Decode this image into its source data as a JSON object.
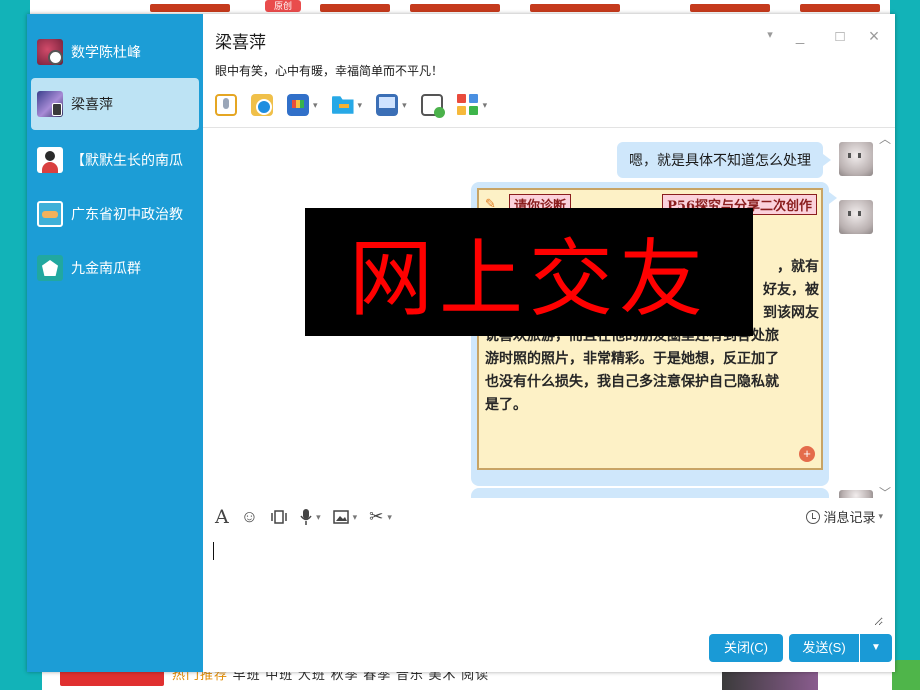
{
  "background_page": {
    "top_tag": "原创",
    "bottom_links": [
      "热门推荐",
      "早班",
      "中班",
      "大班",
      "秋季",
      "春季",
      "音乐",
      "美术",
      "阅读"
    ]
  },
  "sidebar": {
    "items": [
      {
        "label": "数学陈杜峰",
        "active": false
      },
      {
        "label": "梁喜萍",
        "active": true
      },
      {
        "label": "【默默生长的南瓜",
        "active": false
      },
      {
        "label": "广东省初中政治教",
        "active": false
      },
      {
        "label": "九金南瓜群",
        "active": false
      }
    ]
  },
  "header": {
    "title": "梁喜萍",
    "signature": "眼中有笑，心中有暖，幸福简单而不平凡！",
    "controls": {
      "menu": "▾",
      "minimize": "_",
      "maximize": "□",
      "close": "×"
    }
  },
  "toolbar": {
    "tools": [
      "voice-icon",
      "video-icon",
      "screen-share-icon",
      "file-transfer-icon",
      "remote-assist-icon",
      "chat-bubble-icon",
      "apps-icon"
    ]
  },
  "messages": {
    "text_bubble": "嗯，就是具体不知道怎么处理",
    "card": {
      "tag_left": "请你诊断",
      "tag_right": "P56探究与分享二次创作",
      "lines": [
        "，就有",
        "好友，被",
        "到该网友",
        "说喜欢旅游，而且在他的朋友圈里还有到各处旅",
        "游时照的照片，非常精彩。于是她想，反正加了",
        "也没有什么损失，我自己多注意保护自己隐私就",
        "是了。"
      ]
    }
  },
  "overlay_text": "网上交友",
  "input_toolbar": {
    "font": "A",
    "emoji": "☺",
    "history_label": "消息记录"
  },
  "buttons": {
    "close_label": "关闭(C)",
    "send_label": "发送(S)",
    "send_dropdown": "▼"
  },
  "colors": {
    "sidebar": "#1c9dd6",
    "bubble": "#cfe7fb",
    "button": "#1a9ad6",
    "overlay_text": "#ff0000"
  }
}
